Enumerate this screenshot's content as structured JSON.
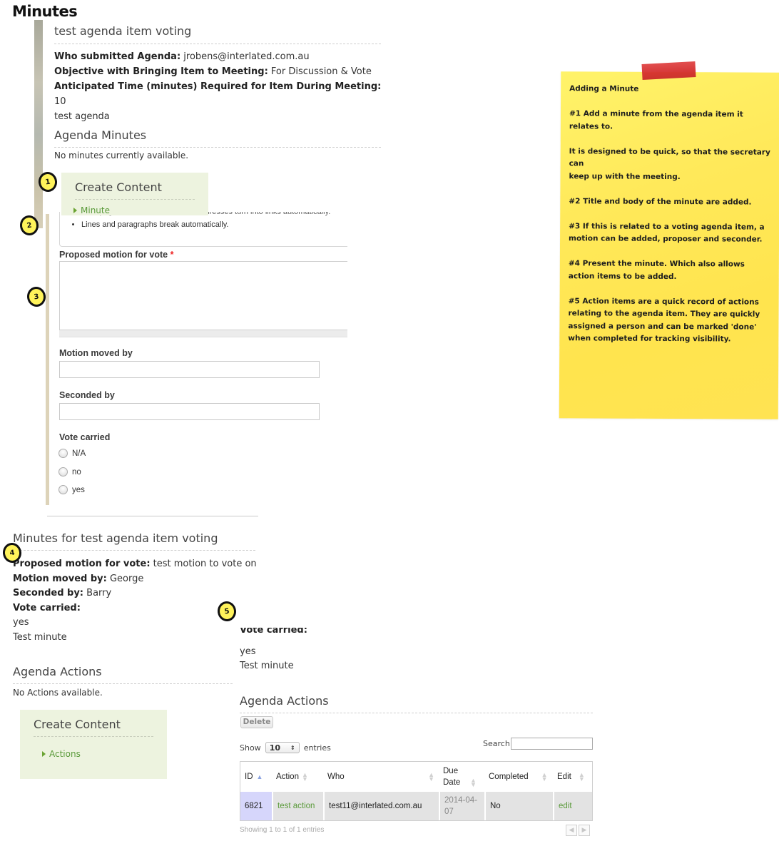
{
  "page": {
    "title": "Minutes"
  },
  "agenda_item": {
    "title": "test agenda item voting",
    "fields": [
      {
        "label": "Who submitted Agenda:",
        "value": "jrobens@interlated.com.au"
      },
      {
        "label": "Objective with Bringing Item to Meeting:",
        "value": "For Discussion & Vote"
      },
      {
        "label": "Anticipated Time (minutes) Required for Item During Meeting:",
        "value": "10"
      }
    ],
    "body": "test agenda"
  },
  "agenda_minutes": {
    "heading": "Agenda Minutes",
    "empty_text": "No minutes currently available."
  },
  "create_content_minute": {
    "title": "Create Content",
    "link": "Minute"
  },
  "minute_form": {
    "help_items": [
      "Web page addresses and e-mail addresses turn into links automatically.",
      "Lines and paragraphs break automatically."
    ],
    "proposed_motion_label": "Proposed motion for vote",
    "required_mark": "*",
    "proposed_motion_value": "",
    "motion_moved_by_label": "Motion moved by",
    "motion_moved_by_value": "",
    "seconded_by_label": "Seconded by",
    "seconded_by_value": "",
    "vote_carried_label": "Vote carried",
    "vote_options": [
      "N/A",
      "no",
      "yes"
    ]
  },
  "minutes_view": {
    "heading": "Minutes for test agenda item voting",
    "fields": [
      {
        "label": "Proposed motion for vote:",
        "value": "test motion to vote on"
      },
      {
        "label": "Motion moved by:",
        "value": "George"
      },
      {
        "label": "Seconded by:",
        "value": "Barry"
      },
      {
        "label": "Vote carried:",
        "value": ""
      }
    ],
    "vote_value": "yes",
    "body": "Test minute"
  },
  "agenda_actions_empty": {
    "heading": "Agenda Actions",
    "empty_text": "No Actions available."
  },
  "create_content_actions": {
    "title": "Create Content",
    "link": "Actions"
  },
  "minutes_view_cropped": {
    "vote_label": "Vote carried:",
    "vote_value": "yes",
    "body": "Test minute"
  },
  "agenda_actions_table": {
    "heading": "Agenda Actions",
    "delete_label": "Delete",
    "show_label": "Show",
    "page_size": "10",
    "entries_label": "entries",
    "search_label": "Search:",
    "search_value": "",
    "columns": [
      "ID",
      "Action",
      "Who",
      "Due Date",
      "Completed",
      "Edit"
    ],
    "rows": [
      {
        "id": "6821",
        "action": "test action",
        "who": "test11@interlated.com.au",
        "due_date": "2014-04-07",
        "completed": "No",
        "edit": "edit"
      }
    ],
    "info": "Showing 1 to 1 of 1 entries",
    "prev_icon": "◀",
    "next_icon": "▶"
  },
  "sticky_note": {
    "title": "Adding a Minute",
    "paragraphs": [
      "#1 Add a minute from the agenda item it relates to.",
      "It is designed to be quick, so that the secretary can\nkeep up with the meeting.",
      "#2 Title and body of the minute are added.",
      "#3 If this is related to a voting agenda item, a motion can be added, proposer and seconder.",
      "#4 Present the minute. Which also allows action items to be added.",
      "#5 Action items are a quick record of actions relating to the agenda item. They are quickly assigned a person and can be marked 'done' when completed for tracking visibility."
    ]
  },
  "markers": [
    "1",
    "2",
    "3",
    "4",
    "5"
  ],
  "colors": {
    "sticky_yellow": "#ffe95a",
    "tape_red": "#d42e2e",
    "link_green": "#5a9a3a",
    "panel_green": "#edf3df",
    "marker_yellow": "#fff35a",
    "id_cell_blue": "#d6d6fb"
  }
}
